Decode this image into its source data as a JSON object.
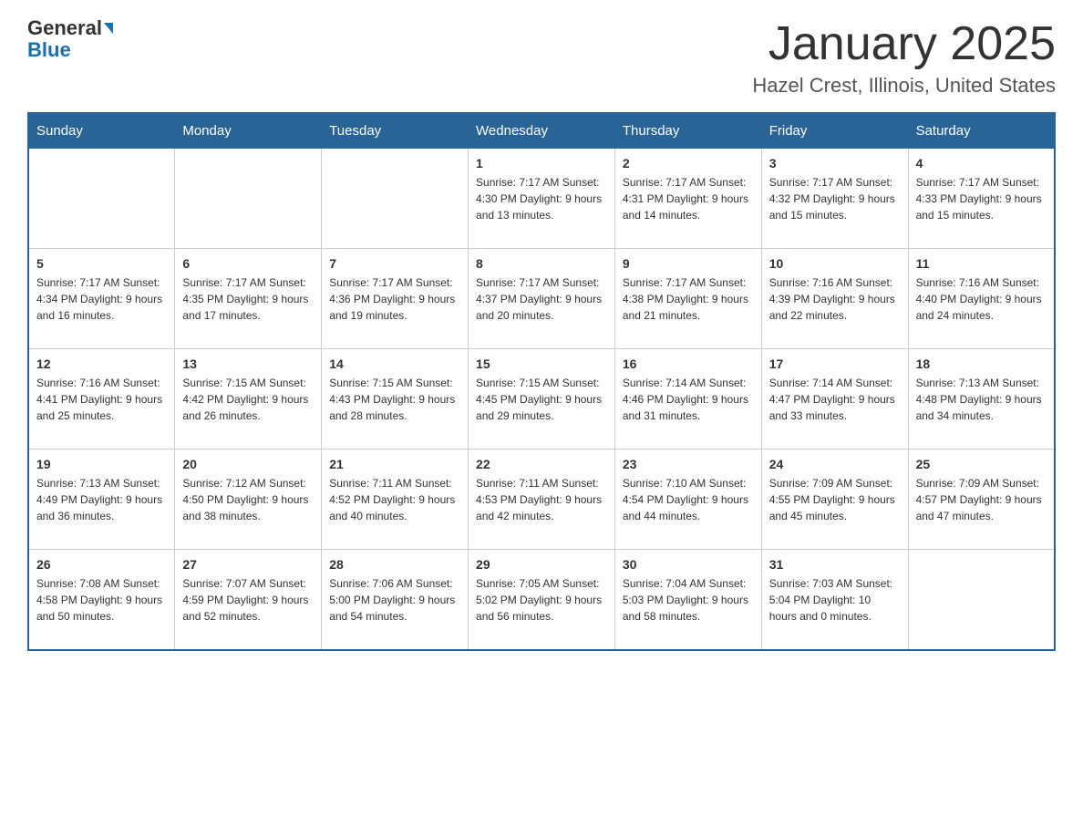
{
  "header": {
    "logo_line1": "General",
    "logo_line2": "Blue",
    "title": "January 2025",
    "subtitle": "Hazel Crest, Illinois, United States"
  },
  "calendar": {
    "days_of_week": [
      "Sunday",
      "Monday",
      "Tuesday",
      "Wednesday",
      "Thursday",
      "Friday",
      "Saturday"
    ],
    "weeks": [
      [
        {
          "day": "",
          "info": ""
        },
        {
          "day": "",
          "info": ""
        },
        {
          "day": "",
          "info": ""
        },
        {
          "day": "1",
          "info": "Sunrise: 7:17 AM\nSunset: 4:30 PM\nDaylight: 9 hours\nand 13 minutes."
        },
        {
          "day": "2",
          "info": "Sunrise: 7:17 AM\nSunset: 4:31 PM\nDaylight: 9 hours\nand 14 minutes."
        },
        {
          "day": "3",
          "info": "Sunrise: 7:17 AM\nSunset: 4:32 PM\nDaylight: 9 hours\nand 15 minutes."
        },
        {
          "day": "4",
          "info": "Sunrise: 7:17 AM\nSunset: 4:33 PM\nDaylight: 9 hours\nand 15 minutes."
        }
      ],
      [
        {
          "day": "5",
          "info": "Sunrise: 7:17 AM\nSunset: 4:34 PM\nDaylight: 9 hours\nand 16 minutes."
        },
        {
          "day": "6",
          "info": "Sunrise: 7:17 AM\nSunset: 4:35 PM\nDaylight: 9 hours\nand 17 minutes."
        },
        {
          "day": "7",
          "info": "Sunrise: 7:17 AM\nSunset: 4:36 PM\nDaylight: 9 hours\nand 19 minutes."
        },
        {
          "day": "8",
          "info": "Sunrise: 7:17 AM\nSunset: 4:37 PM\nDaylight: 9 hours\nand 20 minutes."
        },
        {
          "day": "9",
          "info": "Sunrise: 7:17 AM\nSunset: 4:38 PM\nDaylight: 9 hours\nand 21 minutes."
        },
        {
          "day": "10",
          "info": "Sunrise: 7:16 AM\nSunset: 4:39 PM\nDaylight: 9 hours\nand 22 minutes."
        },
        {
          "day": "11",
          "info": "Sunrise: 7:16 AM\nSunset: 4:40 PM\nDaylight: 9 hours\nand 24 minutes."
        }
      ],
      [
        {
          "day": "12",
          "info": "Sunrise: 7:16 AM\nSunset: 4:41 PM\nDaylight: 9 hours\nand 25 minutes."
        },
        {
          "day": "13",
          "info": "Sunrise: 7:15 AM\nSunset: 4:42 PM\nDaylight: 9 hours\nand 26 minutes."
        },
        {
          "day": "14",
          "info": "Sunrise: 7:15 AM\nSunset: 4:43 PM\nDaylight: 9 hours\nand 28 minutes."
        },
        {
          "day": "15",
          "info": "Sunrise: 7:15 AM\nSunset: 4:45 PM\nDaylight: 9 hours\nand 29 minutes."
        },
        {
          "day": "16",
          "info": "Sunrise: 7:14 AM\nSunset: 4:46 PM\nDaylight: 9 hours\nand 31 minutes."
        },
        {
          "day": "17",
          "info": "Sunrise: 7:14 AM\nSunset: 4:47 PM\nDaylight: 9 hours\nand 33 minutes."
        },
        {
          "day": "18",
          "info": "Sunrise: 7:13 AM\nSunset: 4:48 PM\nDaylight: 9 hours\nand 34 minutes."
        }
      ],
      [
        {
          "day": "19",
          "info": "Sunrise: 7:13 AM\nSunset: 4:49 PM\nDaylight: 9 hours\nand 36 minutes."
        },
        {
          "day": "20",
          "info": "Sunrise: 7:12 AM\nSunset: 4:50 PM\nDaylight: 9 hours\nand 38 minutes."
        },
        {
          "day": "21",
          "info": "Sunrise: 7:11 AM\nSunset: 4:52 PM\nDaylight: 9 hours\nand 40 minutes."
        },
        {
          "day": "22",
          "info": "Sunrise: 7:11 AM\nSunset: 4:53 PM\nDaylight: 9 hours\nand 42 minutes."
        },
        {
          "day": "23",
          "info": "Sunrise: 7:10 AM\nSunset: 4:54 PM\nDaylight: 9 hours\nand 44 minutes."
        },
        {
          "day": "24",
          "info": "Sunrise: 7:09 AM\nSunset: 4:55 PM\nDaylight: 9 hours\nand 45 minutes."
        },
        {
          "day": "25",
          "info": "Sunrise: 7:09 AM\nSunset: 4:57 PM\nDaylight: 9 hours\nand 47 minutes."
        }
      ],
      [
        {
          "day": "26",
          "info": "Sunrise: 7:08 AM\nSunset: 4:58 PM\nDaylight: 9 hours\nand 50 minutes."
        },
        {
          "day": "27",
          "info": "Sunrise: 7:07 AM\nSunset: 4:59 PM\nDaylight: 9 hours\nand 52 minutes."
        },
        {
          "day": "28",
          "info": "Sunrise: 7:06 AM\nSunset: 5:00 PM\nDaylight: 9 hours\nand 54 minutes."
        },
        {
          "day": "29",
          "info": "Sunrise: 7:05 AM\nSunset: 5:02 PM\nDaylight: 9 hours\nand 56 minutes."
        },
        {
          "day": "30",
          "info": "Sunrise: 7:04 AM\nSunset: 5:03 PM\nDaylight: 9 hours\nand 58 minutes."
        },
        {
          "day": "31",
          "info": "Sunrise: 7:03 AM\nSunset: 5:04 PM\nDaylight: 10 hours\nand 0 minutes."
        },
        {
          "day": "",
          "info": ""
        }
      ]
    ]
  }
}
